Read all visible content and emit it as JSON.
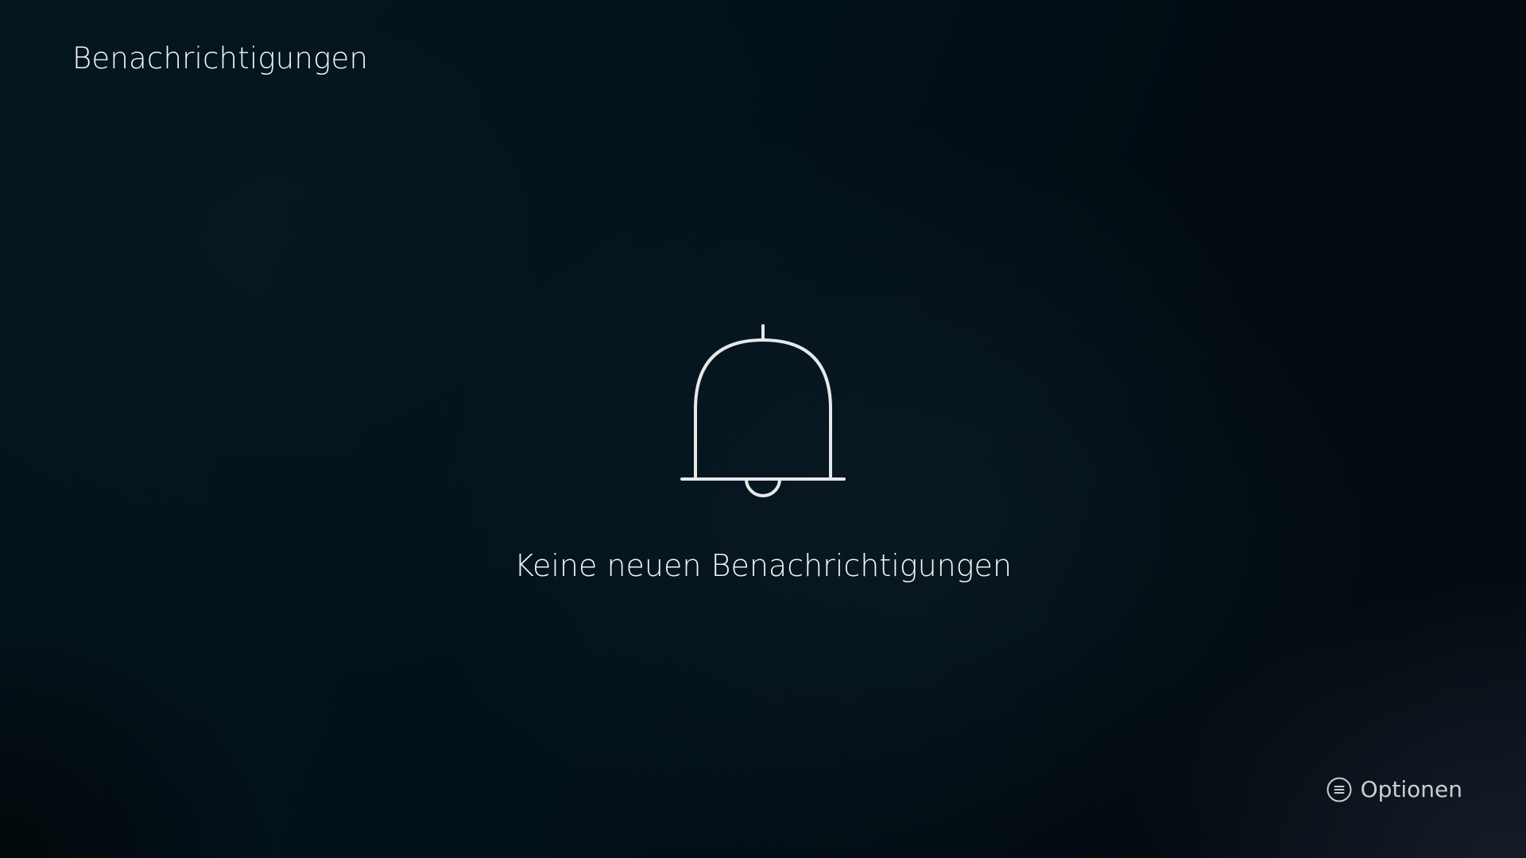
{
  "header": {
    "title": "Benachrichtigungen"
  },
  "empty_state": {
    "icon": "bell-icon",
    "message": "Keine neuen Benachrichtigungen"
  },
  "footer": {
    "options_icon": "menu-button-icon",
    "options_label": "Optionen"
  },
  "colors": {
    "background": "#030d13",
    "text": "#f4f6f7",
    "hint_text": "#c9ced2"
  }
}
